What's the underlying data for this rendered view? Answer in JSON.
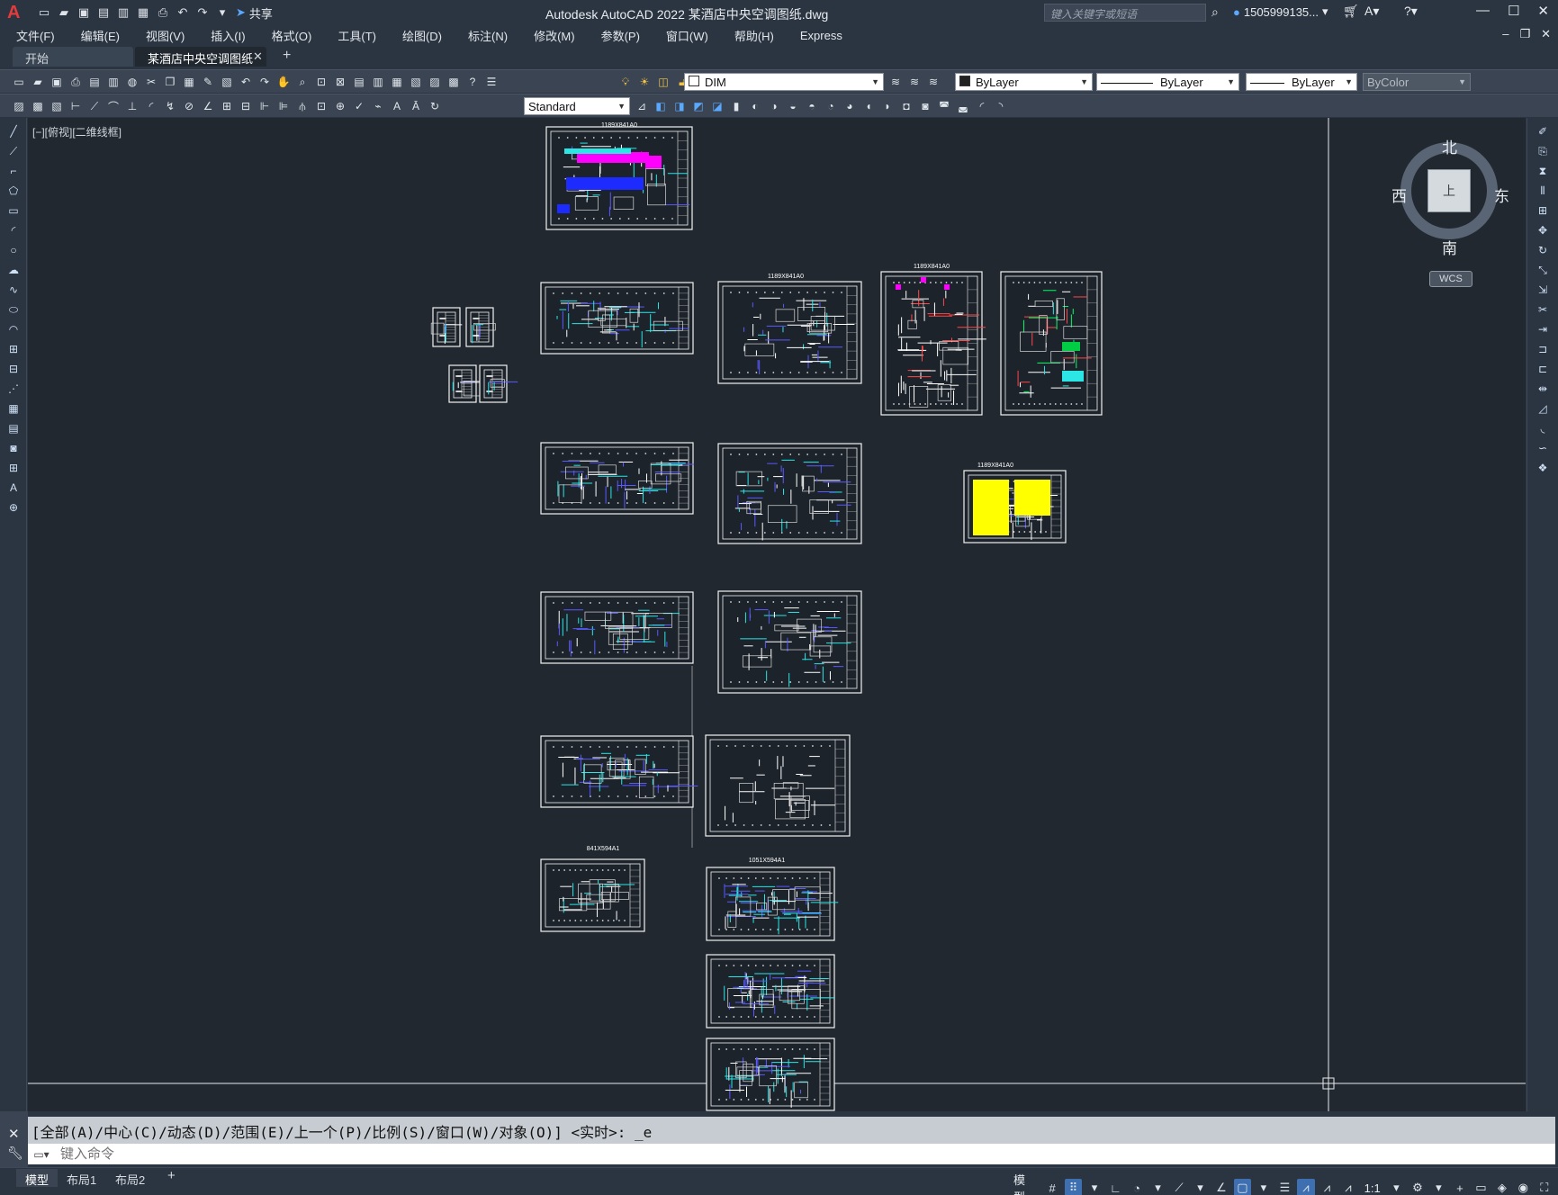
{
  "app": {
    "title": "Autodesk AutoCAD 2022    某酒店中央空调图纸.dwg",
    "logo": "A",
    "share_label": "共享",
    "search_placeholder": "键入关键字或短语",
    "user_label": "1505999135..."
  },
  "menu": [
    "文件(F)",
    "编辑(E)",
    "视图(V)",
    "插入(I)",
    "格式(O)",
    "工具(T)",
    "绘图(D)",
    "标注(N)",
    "修改(M)",
    "参数(P)",
    "窗口(W)",
    "帮助(H)",
    "Express"
  ],
  "tabs": {
    "start": "开始",
    "drawing": "某酒店中央空调图纸*"
  },
  "toolbar": {
    "layer": "DIM",
    "color": "ByLayer",
    "linetype": "ByLayer",
    "lineweight": "ByLayer",
    "plotstyle": "ByColor",
    "dimstyle": "Standard"
  },
  "viewport": {
    "label": "[−][俯视][二维线框]"
  },
  "viewcube": {
    "north": "北",
    "south": "南",
    "east": "东",
    "west": "西",
    "face": "上",
    "wcs": "WCS"
  },
  "sheet_labels": {
    "s1": "1189X841A0",
    "s2": "1189X841A0",
    "s3": "1189X841A0",
    "s4": "1189X841A0",
    "s5": "841X594A1",
    "s6": "841X594A1",
    "s7": "1051X594A1"
  },
  "command": {
    "history": "[全部(A)/中心(C)/动态(D)/范围(E)/上一个(P)/比例(S)/窗口(W)/对象(O)] <实时>: _e",
    "placeholder": "键入命令"
  },
  "layout_tabs": {
    "model": "模型",
    "layout1": "布局1",
    "layout2": "布局2"
  },
  "status": {
    "model_label": "模型",
    "scale": "1:1"
  }
}
